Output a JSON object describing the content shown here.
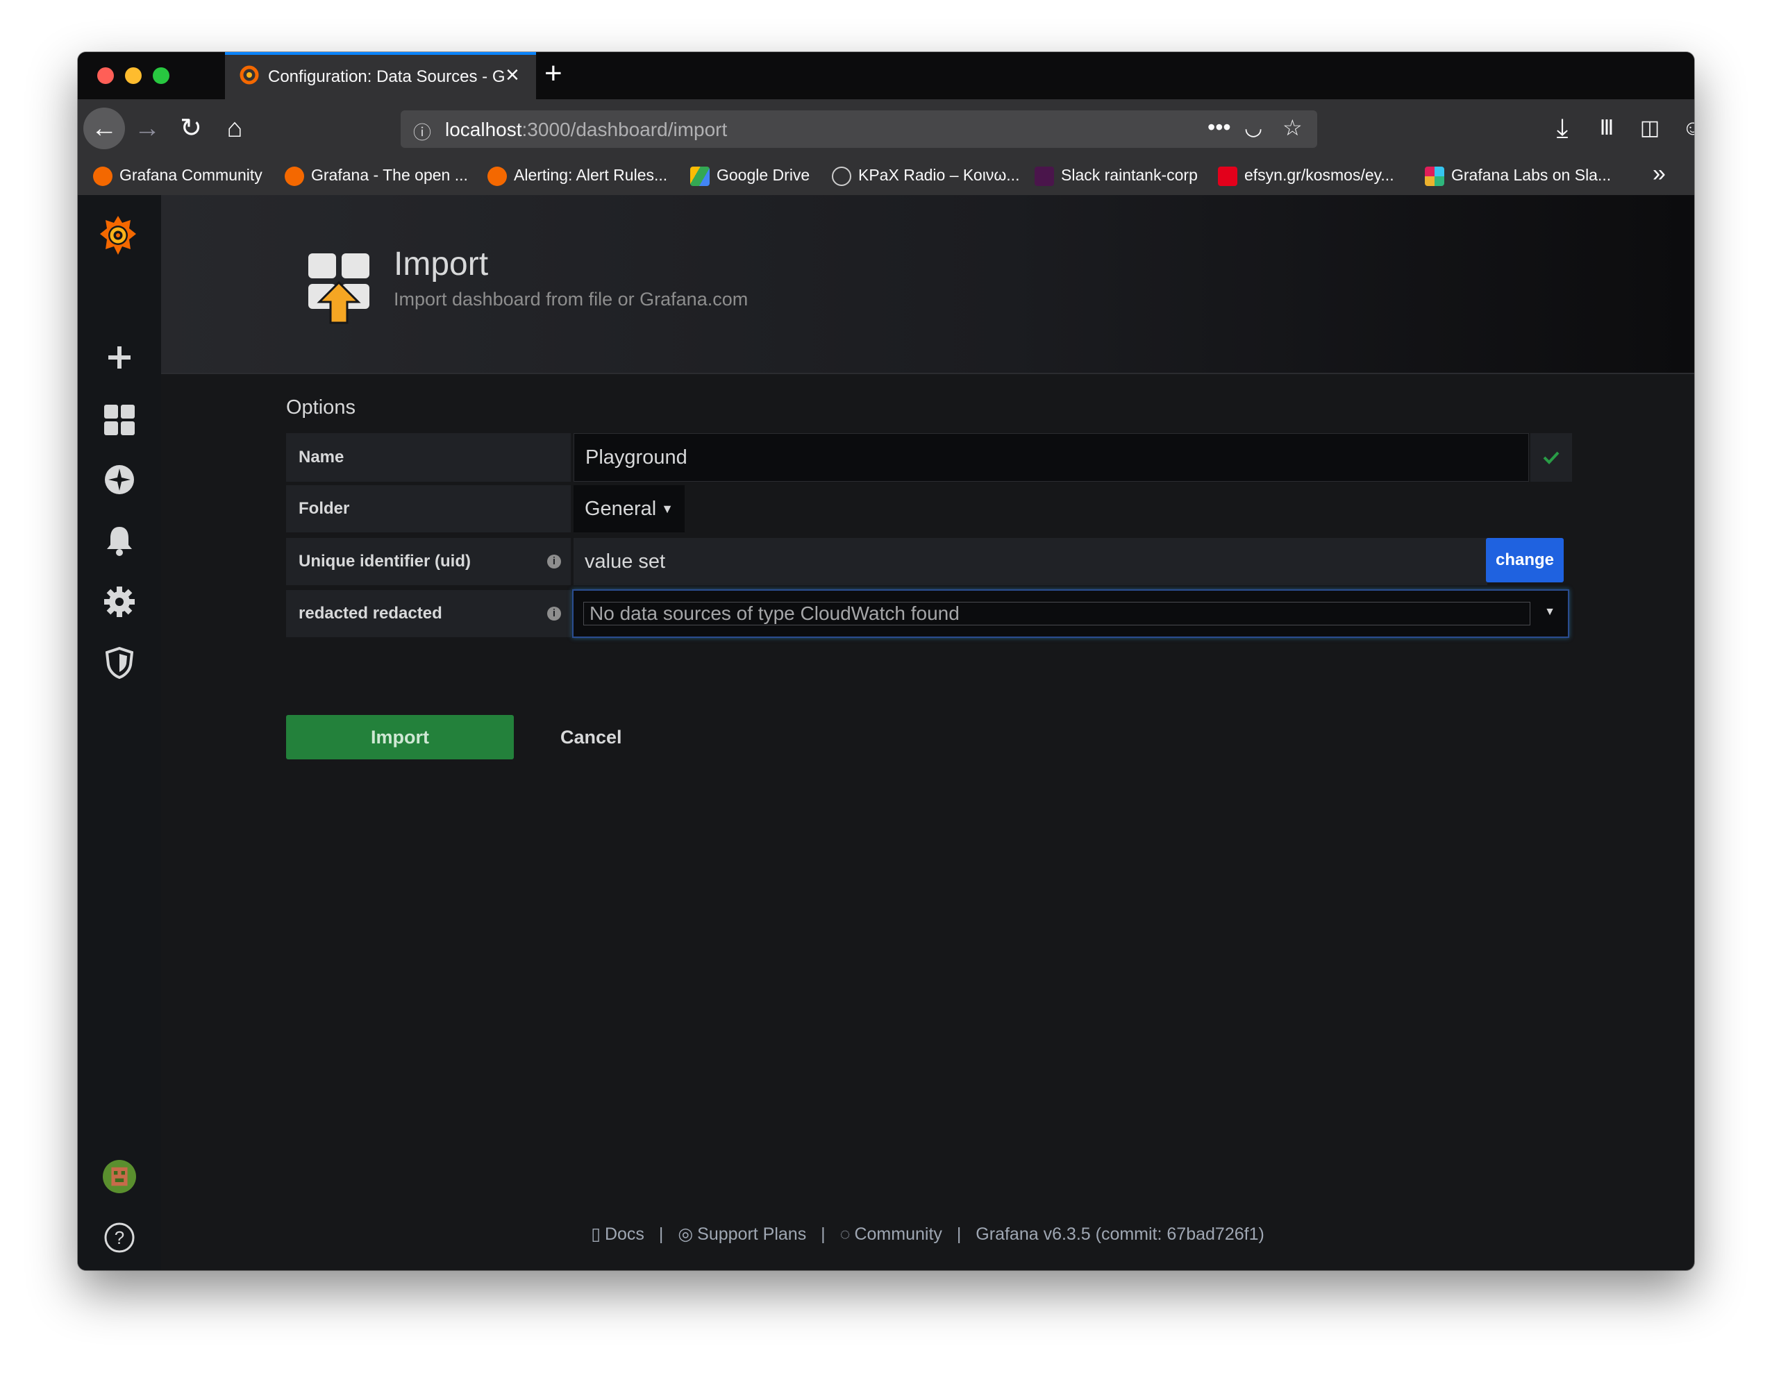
{
  "browser": {
    "tab_title": "Configuration: Data Sources - G",
    "url_host": "localhost",
    "url_path": ":3000/dashboard/import",
    "bookmarks": [
      {
        "label": "Grafana Community",
        "icon": "grafana-logo-icon",
        "color": "#f46800"
      },
      {
        "label": "Grafana - The open ...",
        "icon": "grafana-logo-icon",
        "color": "#f46800"
      },
      {
        "label": "Alerting: Alert Rules...",
        "icon": "grafana-logo-icon",
        "color": "#f46800"
      },
      {
        "label": "Google Drive",
        "icon": "google-drive-icon",
        "color": "#34a853"
      },
      {
        "label": "KPaX Radio – Κοινω...",
        "icon": "globe-icon",
        "color": "#cccccc"
      },
      {
        "label": "Slack raintank-corp",
        "icon": "slack-icon",
        "color": "#4a154b"
      },
      {
        "label": "efsyn.gr/kosmos/ey...",
        "icon": "efsyn-icon",
        "color": "#e3001b"
      },
      {
        "label": "Grafana Labs on Sla...",
        "icon": "slack-icon",
        "color": "#36c5f0"
      }
    ]
  },
  "header": {
    "title": "Import",
    "subtitle": "Import dashboard from file or Grafana.com"
  },
  "options": {
    "section_title": "Options",
    "name_label": "Name",
    "name_value": "Playground",
    "folder_label": "Folder",
    "folder_value": "General",
    "uid_label": "Unique identifier (uid)",
    "uid_value": "value set",
    "uid_change": "change",
    "ds_label": "redacted redacted",
    "ds_placeholder": "No data sources of type CloudWatch found"
  },
  "actions": {
    "import": "Import",
    "cancel": "Cancel"
  },
  "footer": {
    "docs": "Docs",
    "support": "Support Plans",
    "community": "Community",
    "version": "Grafana v6.3.5 (commit: 67bad726f1)",
    "separator": "|"
  },
  "colors": {
    "primary_button": "#23813b",
    "change_button": "#1f62e0",
    "valid_check": "#299c46",
    "grafana_orange": "#f46800"
  }
}
